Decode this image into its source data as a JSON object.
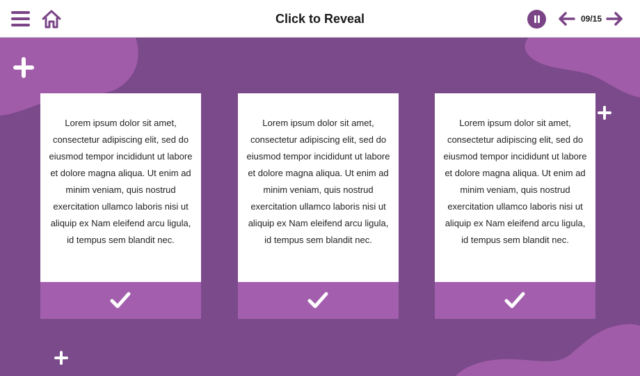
{
  "header": {
    "title": "Click to Reveal",
    "counter": "09/15"
  },
  "colors": {
    "accent": "#7a4487",
    "background": "#7a4a8a",
    "blob": "#a15ca9",
    "check_bar": "#a35fae"
  },
  "icons": [
    "menu-icon",
    "home-icon",
    "pause-icon",
    "arrow-left-icon",
    "arrow-right-icon",
    "checkmark-icon",
    "plus-icon"
  ],
  "cards": [
    {
      "text": "Lorem ipsum dolor sit amet, consectetur adipiscing elit, sed do eiusmod tempor incididunt ut labore et dolore magna aliqua. Ut enim ad minim veniam, quis nostrud exercitation ullamco laboris nisi ut aliquip ex Nam eleifend arcu ligula, id tempus sem blandit nec."
    },
    {
      "text": "Lorem ipsum dolor sit amet, consectetur adipiscing elit, sed do eiusmod tempor incididunt ut labore et dolore magna aliqua. Ut enim ad minim veniam, quis nostrud exercitation ullamco laboris nisi ut aliquip ex Nam eleifend arcu ligula, id tempus sem blandit nec."
    },
    {
      "text": "Lorem ipsum dolor sit amet, consectetur adipiscing elit, sed do eiusmod tempor incididunt ut labore et dolore magna aliqua. Ut enim ad minim veniam, quis nostrud exercitation ullamco laboris nisi ut aliquip ex Nam eleifend arcu ligula, id tempus sem blandit nec."
    }
  ]
}
